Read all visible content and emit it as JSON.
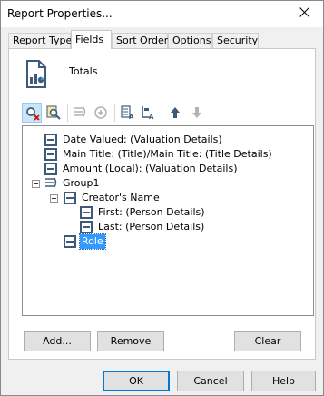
{
  "window": {
    "title": "Report Properties..."
  },
  "tabs": [
    {
      "label": "Report Type",
      "active": false
    },
    {
      "label": "Fields",
      "active": true
    },
    {
      "label": "Sort Order",
      "active": false
    },
    {
      "label": "Options",
      "active": false
    },
    {
      "label": "Security",
      "active": false
    }
  ],
  "header": {
    "label": "Totals",
    "icon": "report-document-icon"
  },
  "toolbar": {
    "buttons": [
      {
        "icon": "find-field-icon",
        "enabled": true,
        "pressed": true
      },
      {
        "icon": "find-next-icon",
        "enabled": true,
        "pressed": false
      },
      {
        "icon": "group-fields-icon",
        "enabled": false
      },
      {
        "icon": "add-calculated-icon",
        "enabled": false
      },
      {
        "icon": "sort-fields-icon",
        "enabled": true
      },
      {
        "icon": "rename-field-icon",
        "enabled": true
      },
      {
        "icon": "move-up-icon",
        "enabled": true
      },
      {
        "icon": "move-down-icon",
        "enabled": false
      }
    ]
  },
  "tree": {
    "nodes": [
      {
        "label": "Date Valued: (Valuation Details)"
      },
      {
        "label": "Main Title: (Title)/Main Title: (Title Details)"
      },
      {
        "label": "Amount (Local): (Valuation Details)"
      },
      {
        "label": "Group1"
      },
      {
        "label": "Creator's Name"
      },
      {
        "label": "First: (Person Details)"
      },
      {
        "label": "Last: (Person Details)"
      },
      {
        "label": "Role",
        "selected": true
      }
    ]
  },
  "panel_buttons": {
    "add": "Add...",
    "remove": "Remove",
    "clear": "Clear"
  },
  "footer": {
    "ok": "OK",
    "cancel": "Cancel",
    "help": "Help"
  }
}
